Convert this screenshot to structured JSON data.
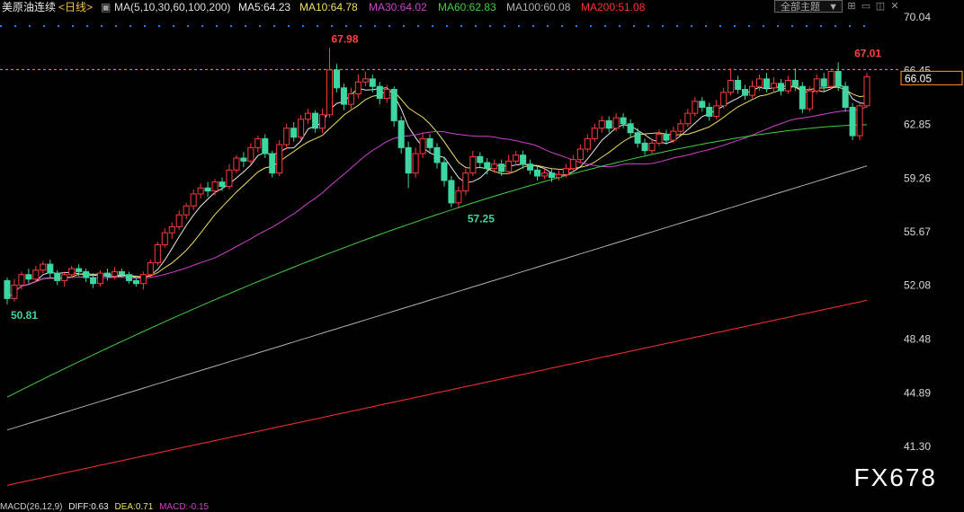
{
  "header": {
    "symbol": "美原油连续",
    "period": "<日线>",
    "ma_params": "MA(5,10,30,60,100,200)",
    "ma5": "MA5:64.23",
    "ma10": "MA10:64.78",
    "ma30": "MA30:64.02",
    "ma60": "MA60:62.83",
    "ma100": "MA100:60.08",
    "ma200": "MA200:51.08",
    "theme_label": "全部主题"
  },
  "macd": {
    "params": "MACD(26,12,9)",
    "diff": "DIFF:0.63",
    "dea": "DEA:0.71",
    "macd": "MACD:-0.15"
  },
  "watermark": "FX678",
  "colors": {
    "up": "#ff3b3b",
    "down": "#3ed6a0",
    "ma5": "#e8e8e8",
    "ma10": "#f0e060",
    "ma30": "#d040d0",
    "ma60": "#40d040",
    "ma100": "#b0b0b0",
    "ma200": "#ff3030",
    "price_line": "#ff9933"
  },
  "chart_data": {
    "type": "candlestick",
    "price_axis_ticks": [
      "70.04",
      "66.45",
      "62.85",
      "59.26",
      "55.67",
      "52.08",
      "48.48",
      "44.89",
      "41.30"
    ],
    "ylim": [
      38.6,
      70.04
    ],
    "last_price": "66.05",
    "annotations": [
      {
        "label": "67.98",
        "index": 45,
        "value": 67.98,
        "kind": "high"
      },
      {
        "label": "57.25",
        "index": 64,
        "value": 57.25,
        "kind": "low"
      },
      {
        "label": "67.01",
        "index": 118,
        "value": 67.01,
        "kind": "high"
      },
      {
        "label": "50.81",
        "index": 0,
        "value": 50.81,
        "kind": "low"
      }
    ],
    "candles": [
      [
        52.4,
        51.2,
        52.6,
        50.81
      ],
      [
        51.2,
        52.1,
        52.5,
        51.0
      ],
      [
        52.1,
        52.8,
        53.0,
        51.8
      ],
      [
        52.8,
        52.5,
        53.2,
        52.2
      ],
      [
        52.5,
        53.1,
        53.4,
        52.3
      ],
      [
        53.1,
        53.5,
        53.7,
        52.9
      ],
      [
        53.5,
        52.9,
        53.8,
        52.6
      ],
      [
        52.9,
        52.4,
        53.1,
        52.1
      ],
      [
        52.4,
        52.8,
        53.0,
        52.0
      ],
      [
        52.8,
        53.2,
        53.4,
        52.6
      ],
      [
        53.2,
        53.0,
        53.5,
        52.7
      ],
      [
        53.0,
        52.6,
        53.2,
        52.3
      ],
      [
        52.6,
        52.2,
        52.9,
        51.9
      ],
      [
        52.2,
        52.9,
        53.1,
        52.0
      ],
      [
        52.9,
        52.7,
        53.2,
        52.4
      ],
      [
        52.7,
        53.0,
        53.3,
        52.5
      ],
      [
        53.0,
        52.8,
        53.2,
        52.6
      ],
      [
        52.8,
        52.4,
        53.0,
        52.2
      ],
      [
        52.4,
        52.2,
        52.6,
        52.0
      ],
      [
        52.2,
        52.8,
        53.0,
        51.8
      ],
      [
        52.8,
        53.6,
        53.8,
        52.6
      ],
      [
        53.6,
        54.8,
        55.0,
        53.4
      ],
      [
        54.8,
        55.6,
        55.9,
        54.6
      ],
      [
        55.6,
        56.0,
        56.3,
        55.2
      ],
      [
        56.0,
        56.8,
        57.1,
        55.8
      ],
      [
        56.8,
        57.4,
        57.6,
        56.5
      ],
      [
        57.4,
        58.2,
        58.5,
        57.1
      ],
      [
        58.2,
        58.6,
        58.9,
        57.9
      ],
      [
        58.6,
        58.4,
        59.0,
        58.0
      ],
      [
        58.4,
        59.0,
        59.2,
        58.1
      ],
      [
        59.0,
        58.7,
        59.3,
        58.4
      ],
      [
        58.7,
        59.8,
        60.2,
        58.5
      ],
      [
        59.8,
        60.6,
        60.8,
        59.6
      ],
      [
        60.6,
        60.4,
        61.0,
        60.0
      ],
      [
        60.4,
        61.3,
        61.6,
        60.2
      ],
      [
        61.3,
        61.9,
        62.1,
        61.0
      ],
      [
        61.9,
        60.9,
        62.2,
        60.6
      ],
      [
        60.9,
        59.6,
        61.1,
        59.3
      ],
      [
        59.6,
        61.5,
        61.8,
        59.4
      ],
      [
        61.5,
        62.6,
        62.9,
        61.2
      ],
      [
        62.6,
        62.0,
        63.0,
        61.7
      ],
      [
        62.0,
        63.2,
        63.5,
        61.8
      ],
      [
        63.2,
        63.6,
        63.9,
        62.9
      ],
      [
        63.6,
        62.6,
        63.8,
        62.3
      ],
      [
        62.6,
        63.5,
        63.9,
        62.3
      ],
      [
        63.5,
        66.5,
        67.98,
        63.3
      ],
      [
        66.5,
        65.3,
        66.9,
        65.0
      ],
      [
        65.3,
        64.2,
        65.6,
        63.8
      ],
      [
        64.2,
        64.9,
        65.3,
        63.9
      ],
      [
        64.9,
        65.7,
        66.2,
        64.6
      ],
      [
        65.7,
        65.9,
        66.4,
        65.4
      ],
      [
        65.9,
        65.4,
        66.2,
        65.0
      ],
      [
        65.4,
        64.6,
        65.7,
        64.2
      ],
      [
        64.6,
        65.2,
        65.5,
        64.3
      ],
      [
        65.2,
        63.1,
        65.4,
        62.7
      ],
      [
        63.1,
        61.3,
        63.4,
        60.9
      ],
      [
        61.3,
        59.6,
        61.7,
        58.6
      ],
      [
        59.6,
        60.9,
        61.3,
        59.3
      ],
      [
        60.9,
        61.9,
        62.3,
        60.6
      ],
      [
        61.9,
        61.3,
        62.2,
        60.9
      ],
      [
        61.3,
        60.3,
        61.6,
        59.9
      ],
      [
        60.3,
        59.1,
        60.6,
        58.7
      ],
      [
        59.1,
        57.6,
        59.4,
        57.3
      ],
      [
        57.6,
        58.4,
        58.7,
        57.25
      ],
      [
        58.4,
        59.6,
        59.9,
        58.1
      ],
      [
        59.6,
        60.7,
        61.1,
        59.4
      ],
      [
        60.7,
        60.3,
        61.0,
        59.9
      ],
      [
        60.3,
        59.9,
        60.6,
        59.5
      ],
      [
        59.9,
        60.2,
        60.5,
        59.6
      ],
      [
        60.2,
        59.7,
        60.5,
        59.4
      ],
      [
        59.7,
        60.4,
        60.8,
        59.5
      ],
      [
        60.4,
        60.8,
        61.1,
        60.1
      ],
      [
        60.8,
        60.2,
        61.1,
        59.9
      ],
      [
        60.2,
        59.8,
        60.5,
        59.5
      ],
      [
        59.8,
        59.4,
        60.1,
        59.1
      ],
      [
        59.4,
        59.6,
        59.9,
        59.2
      ],
      [
        59.6,
        59.3,
        59.9,
        59.0
      ],
      [
        59.3,
        59.5,
        59.8,
        59.1
      ],
      [
        59.5,
        59.9,
        60.2,
        59.3
      ],
      [
        59.9,
        60.5,
        60.8,
        59.7
      ],
      [
        60.5,
        61.2,
        61.5,
        60.3
      ],
      [
        61.2,
        61.9,
        62.2,
        61.0
      ],
      [
        61.9,
        62.6,
        62.9,
        61.7
      ],
      [
        62.6,
        63.1,
        63.4,
        62.3
      ],
      [
        63.1,
        62.6,
        63.4,
        62.3
      ],
      [
        62.6,
        63.3,
        63.6,
        62.4
      ],
      [
        63.3,
        62.9,
        63.6,
        62.6
      ],
      [
        62.9,
        62.3,
        63.2,
        62.0
      ],
      [
        62.3,
        61.6,
        62.6,
        61.3
      ],
      [
        61.6,
        61.1,
        61.9,
        60.8
      ],
      [
        61.1,
        61.6,
        61.9,
        60.9
      ],
      [
        61.6,
        62.2,
        62.5,
        61.4
      ],
      [
        62.2,
        61.8,
        62.5,
        61.5
      ],
      [
        61.8,
        62.4,
        62.7,
        61.6
      ],
      [
        62.4,
        62.9,
        63.2,
        62.2
      ],
      [
        62.9,
        63.6,
        63.9,
        62.7
      ],
      [
        63.6,
        64.4,
        64.7,
        63.4
      ],
      [
        64.4,
        64.0,
        64.7,
        63.7
      ],
      [
        64.0,
        63.4,
        64.3,
        63.1
      ],
      [
        63.4,
        64.1,
        64.5,
        63.2
      ],
      [
        64.1,
        65.0,
        65.3,
        63.9
      ],
      [
        65.0,
        65.8,
        66.6,
        64.8
      ],
      [
        65.8,
        65.2,
        66.1,
        64.9
      ],
      [
        65.2,
        64.8,
        65.5,
        64.5
      ],
      [
        64.8,
        65.4,
        65.8,
        64.6
      ],
      [
        65.4,
        65.9,
        66.2,
        65.1
      ],
      [
        65.9,
        65.3,
        66.3,
        65.0
      ],
      [
        65.3,
        65.6,
        66.0,
        65.0
      ],
      [
        65.6,
        65.1,
        65.9,
        64.8
      ],
      [
        65.1,
        65.8,
        66.1,
        64.9
      ],
      [
        65.8,
        65.4,
        66.6,
        65.1
      ],
      [
        65.4,
        63.9,
        65.7,
        63.6
      ],
      [
        63.9,
        65.1,
        65.4,
        63.7
      ],
      [
        65.1,
        65.9,
        66.2,
        64.9
      ],
      [
        65.9,
        65.4,
        66.3,
        65.1
      ],
      [
        65.4,
        66.4,
        66.6,
        65.2
      ],
      [
        66.4,
        65.4,
        67.01,
        65.1
      ],
      [
        65.4,
        64.0,
        65.7,
        63.7
      ],
      [
        64.0,
        62.1,
        64.3,
        61.8
      ],
      [
        62.1,
        64.1,
        64.4,
        61.8
      ],
      [
        64.1,
        66.05,
        66.3,
        64.0
      ]
    ],
    "ma_lines": [
      {
        "name": "MA5",
        "start": 51.2,
        "end": 64.23
      },
      {
        "name": "MA10",
        "start": 50.5,
        "end": 64.78
      },
      {
        "name": "MA30",
        "start": 48.6,
        "end": 64.02
      },
      {
        "name": "MA60",
        "start": 44.6,
        "end": 62.83
      },
      {
        "name": "MA100",
        "start": 42.4,
        "end": 60.08
      },
      {
        "name": "MA200",
        "start": 38.7,
        "end": 51.08
      }
    ]
  }
}
